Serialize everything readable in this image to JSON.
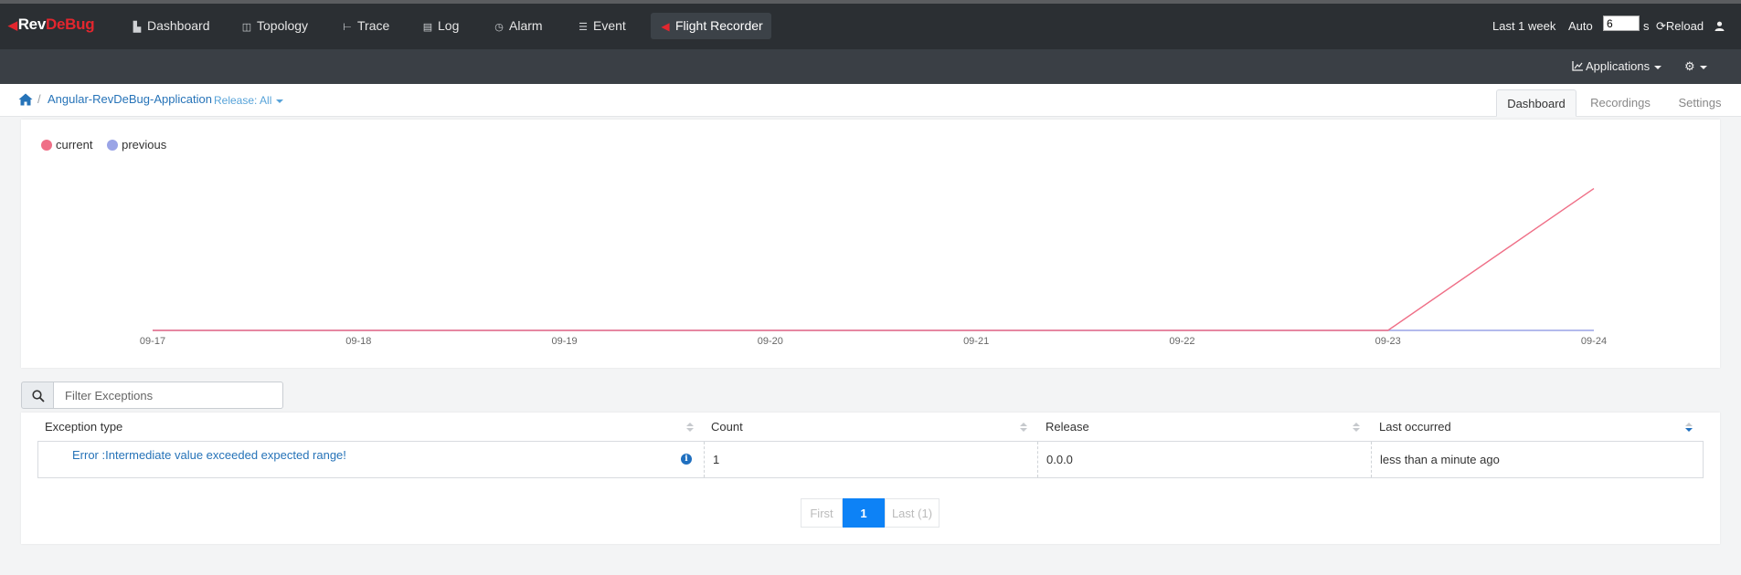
{
  "topbar": {
    "logo_rev": "Rev",
    "logo_debug": "DeBug",
    "nav": [
      {
        "label": "Dashboard",
        "icon": "dashboard-icon"
      },
      {
        "label": "Topology",
        "icon": "topology-icon"
      },
      {
        "label": "Trace",
        "icon": "trace-icon"
      },
      {
        "label": "Log",
        "icon": "log-icon"
      },
      {
        "label": "Alarm",
        "icon": "alarm-icon"
      },
      {
        "label": "Event",
        "icon": "event-icon"
      },
      {
        "label": "Flight Recorder",
        "icon": "flight-recorder-icon",
        "active": true
      }
    ],
    "time_range": "Last 1 week",
    "auto_label": "Auto",
    "auto_value": "6",
    "seconds_unit": "s",
    "reload_label": "Reload"
  },
  "subbar": {
    "applications_label": "Applications"
  },
  "breadcrumb": {
    "app_name": "Angular-RevDeBug-Application",
    "release_filter": "Release: All"
  },
  "tabs": [
    {
      "label": "Dashboard",
      "active": true
    },
    {
      "label": "Recordings"
    },
    {
      "label": "Settings"
    }
  ],
  "chart_data": {
    "type": "line",
    "x": [
      "09-17",
      "09-18",
      "09-19",
      "09-20",
      "09-21",
      "09-22",
      "09-23",
      "09-24"
    ],
    "series": [
      {
        "name": "current",
        "color": "#ef6f87",
        "values": [
          0,
          0,
          0,
          0,
          0,
          0,
          0,
          1
        ]
      },
      {
        "name": "previous",
        "color": "#9aa4e6",
        "values": [
          0,
          0,
          0,
          0,
          0,
          0,
          0,
          0
        ]
      }
    ],
    "ylim": [
      0,
      1.1
    ],
    "legend": "top-left",
    "grid": false
  },
  "filter": {
    "placeholder": "Filter Exceptions"
  },
  "table": {
    "columns": [
      "Exception type",
      "Count",
      "Release",
      "Last occurred"
    ],
    "rows": [
      {
        "exception_type": "Error :Intermediate value exceeded expected range!",
        "count": "1",
        "release": "0.0.0",
        "last_occurred": "less than a minute ago"
      }
    ]
  },
  "pagination": {
    "first": "First",
    "current": "1",
    "last": "Last (1)"
  }
}
